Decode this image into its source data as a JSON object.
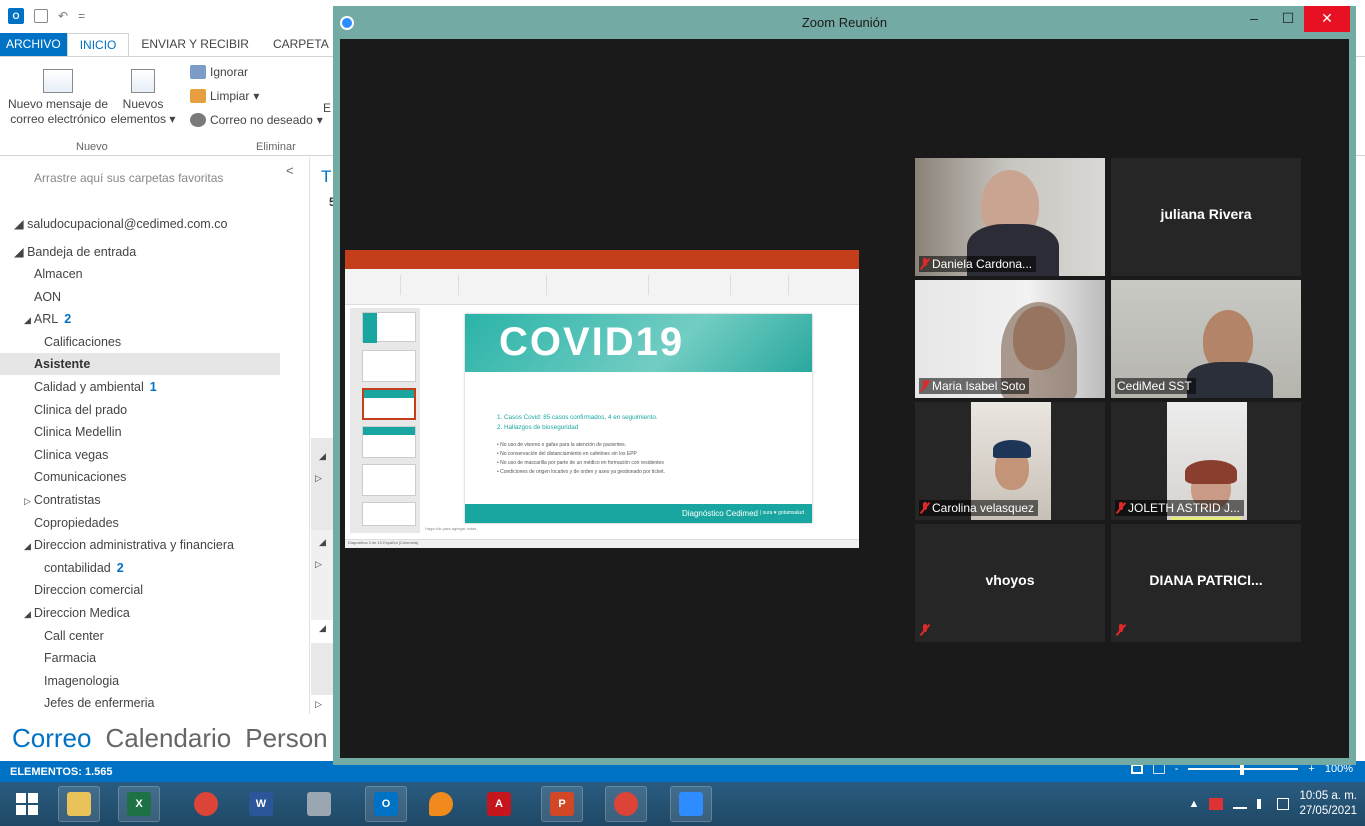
{
  "outlook": {
    "qat_icons": [
      "outlook-icon",
      "save-icon",
      "undo-icon"
    ],
    "qat_overflow": "=",
    "tabs": [
      "ARCHIVO",
      "INICIO",
      "ENVIAR Y RECIBIR",
      "CARPETA"
    ],
    "ribbon": {
      "new_email_line1": "Nuevo mensaje de",
      "new_email_line2": "correo electrónico",
      "new_items_line1": "Nuevos",
      "new_items_line2": "elementos",
      "ignore": "Ignorar",
      "clean": "Limpiar",
      "junk": "Correo no deseado",
      "truncated": "E",
      "group_new": "Nuevo",
      "group_delete": "Eliminar"
    },
    "favorites_hint": "Arrastre aquí sus carpetas favoritas",
    "collapse_glyph": "<",
    "account": "saludocupacional@cedimed.com.co",
    "inbox": "Bandeja de entrada",
    "folders": [
      {
        "label": "Almacen",
        "indent": 1
      },
      {
        "label": "AON",
        "indent": 1
      },
      {
        "label": "ARL",
        "indent": 1,
        "count": "2",
        "exp": "◢"
      },
      {
        "label": "Calificaciones",
        "indent": 2
      },
      {
        "label": "Asistente",
        "indent": 1,
        "selected": true
      },
      {
        "label": "Calidad y ambiental",
        "indent": 1,
        "count": "1"
      },
      {
        "label": "Clinica del prado",
        "indent": 1
      },
      {
        "label": "Clinica Medellin",
        "indent": 1
      },
      {
        "label": "Clinica vegas",
        "indent": 1
      },
      {
        "label": "Comunicaciones",
        "indent": 1
      },
      {
        "label": "Contratistas",
        "indent": 1,
        "exp": "▷"
      },
      {
        "label": "Copropiedades",
        "indent": 1
      },
      {
        "label": "Direccion administrativa y financiera",
        "indent": 1,
        "exp": "◢"
      },
      {
        "label": "contabilidad",
        "indent": 2,
        "count": "2"
      },
      {
        "label": "Direccion comercial",
        "indent": 1
      },
      {
        "label": "Direccion Medica",
        "indent": 1,
        "exp": "◢"
      },
      {
        "label": "Call center",
        "indent": 2
      },
      {
        "label": "Farmacia",
        "indent": 2
      },
      {
        "label": "Imagenologia",
        "indent": 2
      },
      {
        "label": "Jefes de enfermeria",
        "indent": 2
      }
    ],
    "midcol_marks": {
      "t": "T",
      "five": "5",
      "a1": "◢",
      "p1": "▷",
      "a2": "◢",
      "p2": "▷",
      "a3": "◢",
      "p3": "▷"
    },
    "nav": [
      "Correo",
      "Calendario",
      "Person"
    ],
    "status_items": "ELEMENTOS: 1.565",
    "zoom_level": "100%",
    "zoom_minus": "-",
    "zoom_plus": "+"
  },
  "zoom": {
    "title": "Zoom Reunión",
    "win_min": "–",
    "win_max": "☐",
    "win_close": "✕",
    "participants": [
      {
        "name": "Daniela Cardona...",
        "video": true,
        "muted": true
      },
      {
        "name": "juliana Rivera",
        "video": false,
        "muted": false
      },
      {
        "name": "Maria Isabel Soto",
        "video": true,
        "muted": true
      },
      {
        "name": "CediMed SST",
        "video": true,
        "muted": false,
        "active": true
      },
      {
        "name": "Carolina velasquez",
        "video": true,
        "muted": true
      },
      {
        "name": "JOLETH ASTRID J...",
        "video": true,
        "muted": true
      },
      {
        "name": "vhoyos",
        "video": false,
        "muted": true
      },
      {
        "name": "DIANA PATRICI...",
        "video": false,
        "muted": true
      }
    ],
    "shared_slide": {
      "banner": "COVID19",
      "items": [
        "1.   Casos Covid: 85 casos confirmados, 4 en seguimiento.",
        "2.   Hallazgos de bioseguridad"
      ],
      "bullets": [
        "•  No uso de visores o gafas para la atención de pacientes.",
        "•  No conservación del distanciamiento en cafetines sin los EPP",
        "•  No uso de mascarilla por parte de un médico en formación con residentes",
        "•  Condiciones de origen locativo y de orden y aseo ya gestionado por ticket."
      ],
      "footer": "Diagnóstico Cedimed",
      "footer_logo": "| sura ♥ gotamsalud",
      "notes_hint": "Haga clic para agregar notas",
      "status_left": "Diapositiva 3 de 10    Español (Colombia)"
    }
  },
  "taskbar": {
    "apps": [
      {
        "name": "start",
        "icon": "windows-icon",
        "glyph": "",
        "color": "#ffffff",
        "open": false
      },
      {
        "name": "explorer",
        "icon": "folder-icon",
        "glyph": "",
        "color": "#e9c25a",
        "open": true
      },
      {
        "name": "excel",
        "icon": "excel-icon",
        "glyph": "X",
        "color": "#1d7245",
        "open": true
      },
      {
        "name": "chrome",
        "icon": "chrome-icon",
        "glyph": "",
        "color": "#db4437",
        "open": false
      },
      {
        "name": "word",
        "icon": "word-icon",
        "glyph": "W",
        "color": "#2b579a",
        "open": false
      },
      {
        "name": "calculator",
        "icon": "calculator-icon",
        "glyph": "",
        "color": "#9aa6b2",
        "open": false
      },
      {
        "name": "outlook",
        "icon": "outlook-icon",
        "glyph": "O",
        "color": "#0072c6",
        "open": true
      },
      {
        "name": "flame",
        "icon": "flame-icon",
        "glyph": "",
        "color": "#f08a1c",
        "open": false
      },
      {
        "name": "acrobat",
        "icon": "acrobat-icon",
        "glyph": "A",
        "color": "#c4161c",
        "open": false
      },
      {
        "name": "powerpoint",
        "icon": "powerpoint-icon",
        "glyph": "P",
        "color": "#d24726",
        "open": true
      },
      {
        "name": "chrome-profile",
        "icon": "chrome-profile-icon",
        "glyph": "",
        "color": "#db4437",
        "open": true
      },
      {
        "name": "zoom",
        "icon": "zoom-icon",
        "glyph": "",
        "color": "#2d8cff",
        "open": true
      }
    ],
    "tray_icons": [
      "tray-up-icon",
      "tray-flag-icon",
      "network-icon",
      "volume-icon",
      "language-icon"
    ],
    "tray_up": "▲",
    "time": "10:05 a. m.",
    "date": "27/05/2021"
  }
}
